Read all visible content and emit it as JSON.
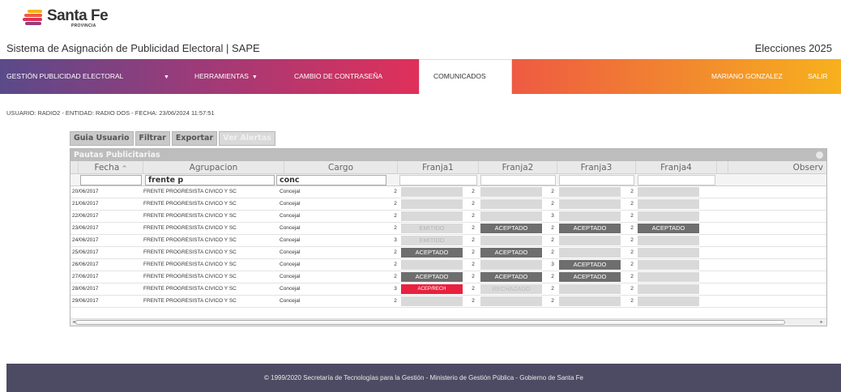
{
  "header": {
    "logo_text": "Santa Fe",
    "logo_sub": "PROVINCIA",
    "system_title": "Sistema de Asignación de Publicidad Electoral | SAPE",
    "election": "Elecciones 2025"
  },
  "nav": {
    "gestion": "GESTIÓN PUBLICIDAD ELECTORAL",
    "herramientas": "HERRAMIENTAS",
    "cambio": "CAMBIO DE CONTRASEÑA",
    "comunicados": "COMUNICADOS",
    "user": "MARIANO GONZALEZ",
    "salir": "SALIR"
  },
  "user_info": "USUARIO: RADIO2 - ENTIDAD: RADIO DOS - FECHA: 23/06/2024 11:57:51",
  "toolbar": {
    "guia": "Guia Usuario",
    "filtrar": "Filtrar",
    "exportar": "Exportar",
    "alertas": "Ver Alertas"
  },
  "grid": {
    "title": "Pautas Publicitarias",
    "columns": {
      "fecha": "Fecha",
      "agrupacion": "Agrupacion",
      "cargo": "Cargo",
      "franja1": "Franja1",
      "franja2": "Franja2",
      "franja3": "Franja3",
      "franja4": "Franja4",
      "observ": "Observ"
    },
    "filters": {
      "agrupacion": "frente p",
      "cargo": "conc"
    },
    "rows": [
      {
        "fecha": "20/06/2017",
        "agrupacion": "FRENTE PROGRESISTA CIVICO Y SC",
        "cargo": "Concejal",
        "n1": "2",
        "f1": "",
        "n2": "2",
        "f2": "",
        "n3": "2",
        "f3": "",
        "n4": "2",
        "f4": ""
      },
      {
        "fecha": "21/06/2017",
        "agrupacion": "FRENTE PROGRESISTA CIVICO Y SC",
        "cargo": "Concejal",
        "n1": "2",
        "f1": "",
        "n2": "2",
        "f2": "",
        "n3": "2",
        "f3": "",
        "n4": "2",
        "f4": ""
      },
      {
        "fecha": "22/06/2017",
        "agrupacion": "FRENTE PROGRESISTA CIVICO Y SC",
        "cargo": "Concejal",
        "n1": "2",
        "f1": "",
        "n2": "2",
        "f2": "",
        "n3": "3",
        "f3": "",
        "n4": "2",
        "f4": ""
      },
      {
        "fecha": "23/06/2017",
        "agrupacion": "FRENTE PROGRESISTA CIVICO Y SC",
        "cargo": "Concejal",
        "n1": "2",
        "f1": "EMITIDO",
        "n2": "2",
        "f2": "ACEPTADO",
        "n3": "2",
        "f3": "ACEPTADO",
        "n4": "2",
        "f4": "ACEPTADO"
      },
      {
        "fecha": "24/06/2017",
        "agrupacion": "FRENTE PROGRESISTA CIVICO Y SC",
        "cargo": "Concejal",
        "n1": "3",
        "f1": "EMITIDO",
        "n2": "2",
        "f2": "",
        "n3": "2",
        "f3": "",
        "n4": "2",
        "f4": ""
      },
      {
        "fecha": "25/06/2017",
        "agrupacion": "FRENTE PROGRESISTA CIVICO Y SC",
        "cargo": "Concejal",
        "n1": "2",
        "f1": "ACEPTADO",
        "n2": "2",
        "f2": "ACEPTADO",
        "n3": "2",
        "f3": "",
        "n4": "2",
        "f4": ""
      },
      {
        "fecha": "26/06/2017",
        "agrupacion": "FRENTE PROGRESISTA CIVICO Y SC",
        "cargo": "Concejal",
        "n1": "2",
        "f1": "",
        "n2": "2",
        "f2": "",
        "n3": "3",
        "f3": "ACEPTADO",
        "n4": "2",
        "f4": ""
      },
      {
        "fecha": "27/06/2017",
        "agrupacion": "FRENTE PROGRESISTA CIVICO Y SC",
        "cargo": "Concejal",
        "n1": "2",
        "f1": "ACEPTADO",
        "n2": "2",
        "f2": "ACEPTADO",
        "n3": "2",
        "f3": "ACEPTADO",
        "n4": "2",
        "f4": ""
      },
      {
        "fecha": "28/06/2017",
        "agrupacion": "FRENTE PROGRESISTA CIVICO Y SC",
        "cargo": "Concejal",
        "n1": "3",
        "f1": "ACEP/RECH",
        "n2": "2",
        "f2": "RECHAZADO",
        "n3": "2",
        "f3": "",
        "n4": "2",
        "f4": ""
      },
      {
        "fecha": "29/06/2017",
        "agrupacion": "FRENTE PROGRESISTA CIVICO Y SC",
        "cargo": "Concejal",
        "n1": "2",
        "f1": "",
        "n2": "2",
        "f2": "",
        "n3": "2",
        "f3": "",
        "n4": "2",
        "f4": ""
      }
    ]
  },
  "footer": "© 1999/2020 Secretaría de Tecnologías para la Gestión - Ministerio de Gestión Pública - Gobierno de Santa Fe",
  "colors": {
    "aceptado": "#6e6e6e",
    "acep_rech": "#e8213f",
    "footer_bg": "#4d4b63"
  }
}
